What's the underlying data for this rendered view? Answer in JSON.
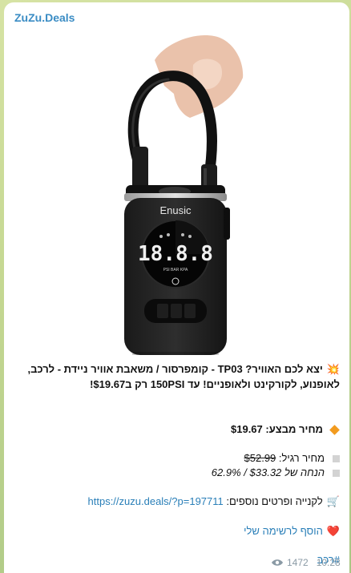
{
  "channel": {
    "name": "ZuZu.Deals"
  },
  "product_image": {
    "brand_text": "Enusic",
    "display_digits": "18.8.8",
    "display_small": "PSI  BAR  KPA",
    "alt": "compressor"
  },
  "post": {
    "title_emoji": "💥",
    "title": "יצא לכם האוויר? TP03 - קומפרסור / משאבת אוויר ניידת - לרכב, לאופנוע, לקורקינט ולאופניים! עד 150PSI רק ב$19.67!",
    "sale_price_label": "מחיר מבצע:",
    "sale_price_value": "$19.67",
    "regular_price_label": "מחיר רגיל:",
    "regular_price_value": "$52.99",
    "discount_label": "הנחה של",
    "discount_value": "$33.32 / 62.9%",
    "link_label": "לקנייה ופרטים נוספים:",
    "link_url": "https://zuzu.deals/?p=197711",
    "wishlist_label": "הוסף לרשימה שלי",
    "hashtag": "#רכב"
  },
  "meta": {
    "views": "1472",
    "time": "10:28"
  },
  "colors": {
    "accent": "#3a8cc4",
    "link": "#2a7fb8",
    "diamond": "#f29b1f"
  }
}
